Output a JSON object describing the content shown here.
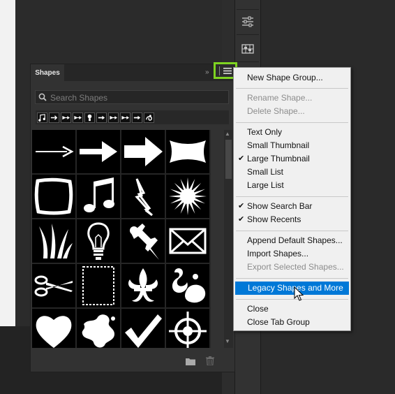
{
  "panel": {
    "tab_label": "Shapes",
    "search_placeholder": "Search Shapes",
    "recents": [
      "music-note-icon",
      "arrow-icon",
      "bow-arrow-icon",
      "bow-arrow-icon",
      "lightbulb-icon",
      "arrow-right-icon",
      "bow-arrow-icon",
      "bow-arrow-icon",
      "arrow-right-icon",
      "fancy-icon"
    ],
    "shapes": [
      "thin-arrow",
      "arrow",
      "bold-arrow",
      "banner",
      "frame",
      "music-notes",
      "lightning",
      "sun-burst",
      "grass",
      "lightbulb",
      "push-pin",
      "envelope",
      "scissors",
      "stamp-frame",
      "fleur-de-lis",
      "ornament",
      "heart",
      "splat",
      "checkmark",
      "target"
    ]
  },
  "menu": {
    "items": [
      {
        "label": "New Shape Group...",
        "state": "normal",
        "checked": false
      },
      {
        "label": "Rename Shape...",
        "state": "disabled",
        "checked": false
      },
      {
        "label": "Delete Shape...",
        "state": "disabled",
        "checked": false
      },
      {
        "label": "Text Only",
        "state": "normal",
        "checked": false
      },
      {
        "label": "Small Thumbnail",
        "state": "normal",
        "checked": false
      },
      {
        "label": "Large Thumbnail",
        "state": "normal",
        "checked": true
      },
      {
        "label": "Small List",
        "state": "normal",
        "checked": false
      },
      {
        "label": "Large List",
        "state": "normal",
        "checked": false
      },
      {
        "label": "Show Search Bar",
        "state": "normal",
        "checked": true
      },
      {
        "label": "Show Recents",
        "state": "normal",
        "checked": true
      },
      {
        "label": "Append Default Shapes...",
        "state": "normal",
        "checked": false
      },
      {
        "label": "Import Shapes...",
        "state": "normal",
        "checked": false
      },
      {
        "label": "Export Selected Shapes...",
        "state": "disabled",
        "checked": false
      },
      {
        "label": "Legacy Shapes and More",
        "state": "highlighted",
        "checked": false
      },
      {
        "label": "Close",
        "state": "normal",
        "checked": false
      },
      {
        "label": "Close Tab Group",
        "state": "normal",
        "checked": false
      }
    ]
  },
  "colors": {
    "highlight": "#0078d7",
    "callout": "#7ed321"
  }
}
